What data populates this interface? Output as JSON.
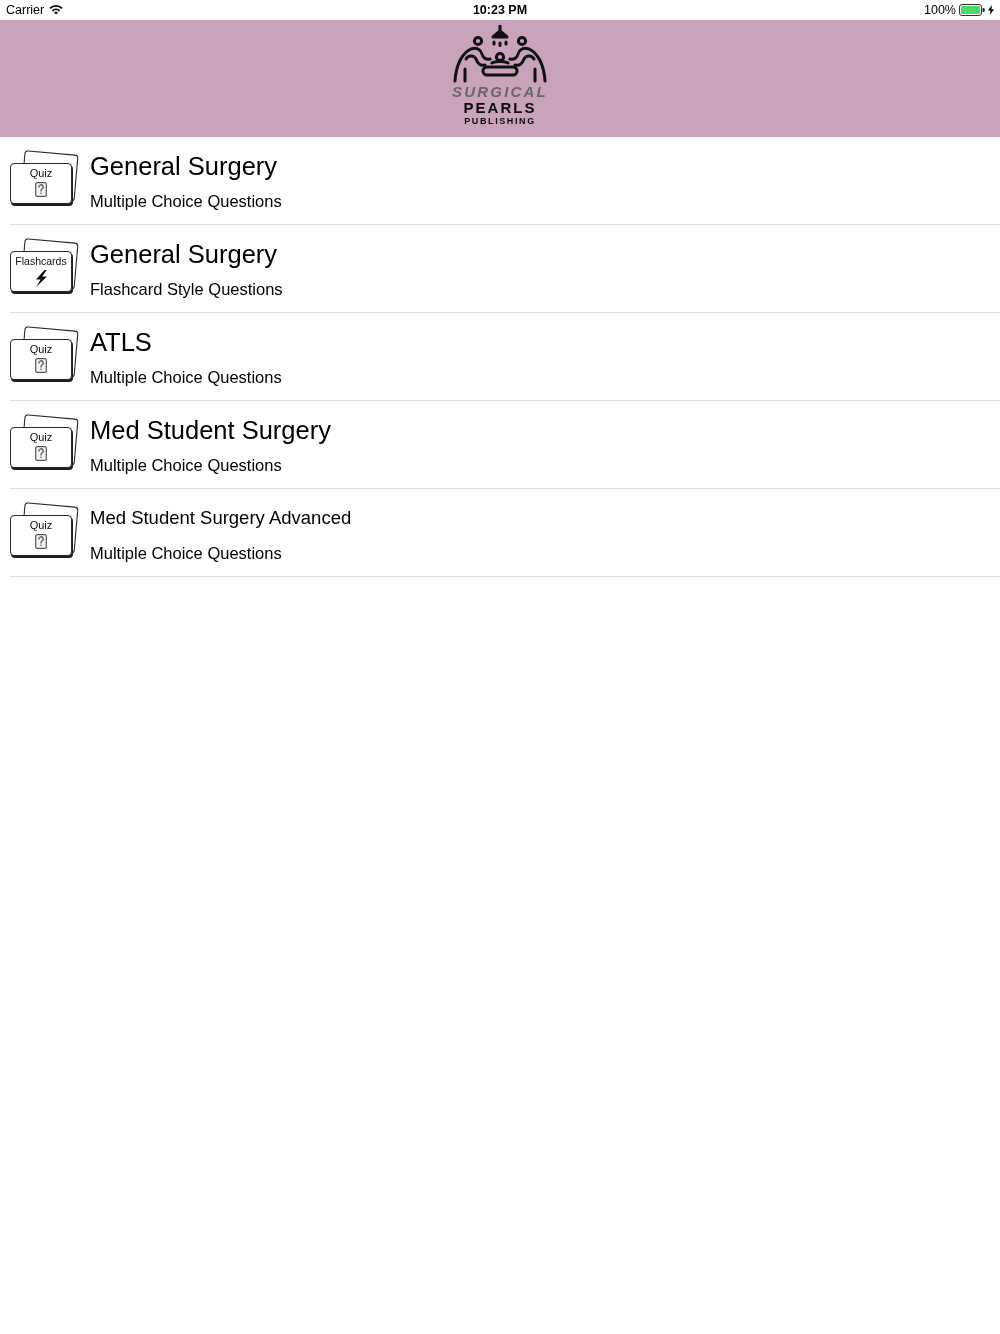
{
  "status_bar": {
    "carrier": "Carrier",
    "time": "10:23 PM",
    "battery": "100%"
  },
  "header": {
    "logo": {
      "line_1": "SURGICAL",
      "line_2": "PEARLS",
      "line_3": "PUBLISHING"
    }
  },
  "items": [
    {
      "kind": "quiz",
      "badge": "Quiz",
      "title": "General Surgery",
      "subtitle": "Multiple Choice Questions"
    },
    {
      "kind": "flashcards",
      "badge": "Flashcards",
      "title": "General Surgery",
      "subtitle": "Flashcard Style Questions"
    },
    {
      "kind": "quiz",
      "badge": "Quiz",
      "title": "ATLS",
      "subtitle": "Multiple Choice Questions"
    },
    {
      "kind": "quiz",
      "badge": "Quiz",
      "title": "Med Student Surgery",
      "subtitle": "Multiple Choice Questions"
    },
    {
      "kind": "quiz",
      "badge": "Quiz",
      "title": "Med Student Surgery Advanced",
      "subtitle": "Multiple Choice Questions"
    }
  ]
}
